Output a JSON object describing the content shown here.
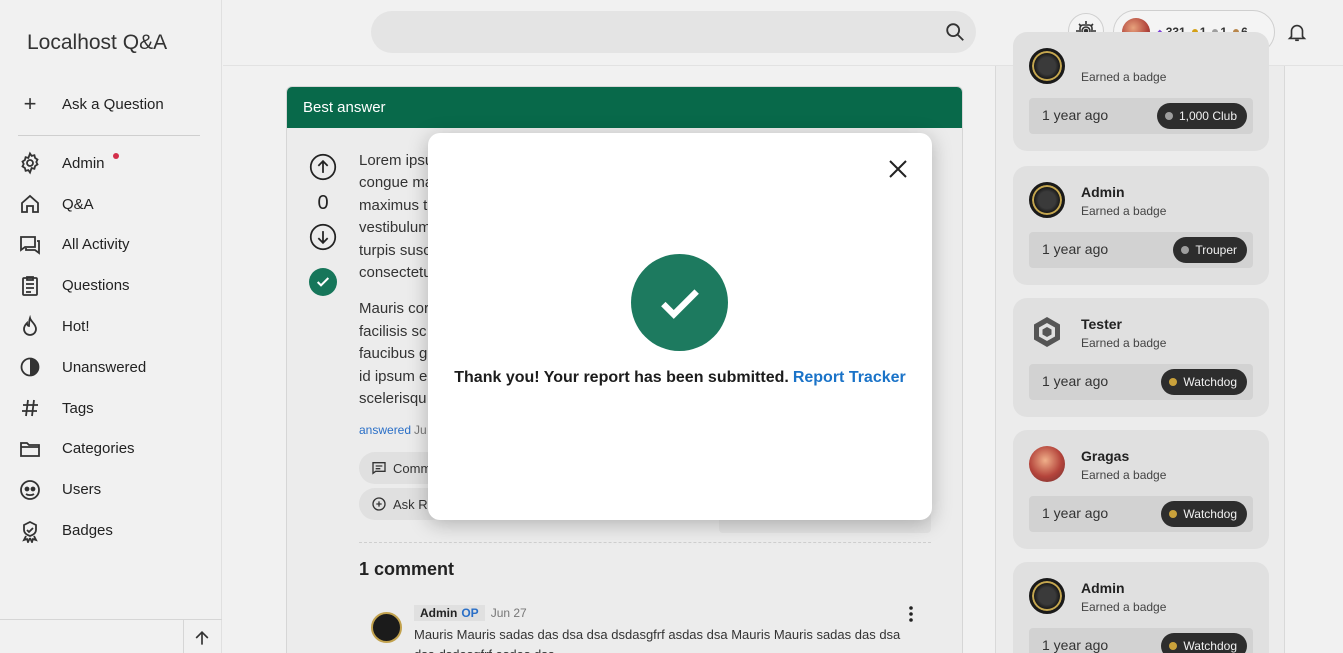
{
  "app": {
    "title": "Localhost Q&A"
  },
  "sidebar": {
    "ask_label": "Ask a Question",
    "items": [
      {
        "label": "Admin",
        "icon": "gear-icon",
        "notify": true
      },
      {
        "label": "Q&A",
        "icon": "home-icon"
      },
      {
        "label": "All Activity",
        "icon": "forum-icon"
      },
      {
        "label": "Questions",
        "icon": "clipboard-icon"
      },
      {
        "label": "Hot!",
        "icon": "flame-icon"
      },
      {
        "label": "Unanswered",
        "icon": "half-circle-icon"
      },
      {
        "label": "Tags",
        "icon": "hash-icon"
      },
      {
        "label": "Categories",
        "icon": "folder-icon"
      },
      {
        "label": "Users",
        "icon": "users-icon"
      },
      {
        "label": "Badges",
        "icon": "badge-icon"
      }
    ]
  },
  "header": {
    "user": {
      "reputation": "331",
      "gold": "1",
      "silver": "1",
      "bronze": "6",
      "colors": {
        "diamond": "#7b3fd6",
        "gold": "#d4a017",
        "silver": "#9e9e9e",
        "bronze": "#b8864b"
      }
    }
  },
  "answer": {
    "header": "Best answer",
    "votes": "0",
    "paragraph1": "Lorem ipsu\ncongue ma\nmaximus t\nvestibulum\nturpis susc\nconsectetu",
    "paragraph2": "Mauris cor\nfacilisis sc\nfaucibus g\nid ipsum e\nscelerisqu",
    "answered_label": "answered",
    "answered_date": "Ju",
    "comment_button": "Comm",
    "ask_related_button": "Ask Re",
    "accent_color": "#08694a"
  },
  "comments": {
    "title": "1 comment",
    "items": [
      {
        "author": "Admin",
        "op_badge": "OP",
        "date": "Jun 27",
        "text": "Mauris Mauris sadas das dsa dsa dsdasgfrf asdas dsa Mauris Mauris sadas das dsa dsa dsdasgfrf asdas dsa"
      }
    ]
  },
  "activity": [
    {
      "name": "",
      "action": "Earned a badge",
      "time": "1 year ago",
      "badge": "1,000 Club",
      "badge_color": "#9e9e9e",
      "avatar": "gold"
    },
    {
      "name": "Admin",
      "action": "Earned a badge",
      "time": "1 year ago",
      "badge": "Trouper",
      "badge_color": "#9e9e9e",
      "avatar": "gold"
    },
    {
      "name": "Tester",
      "action": "Earned a badge",
      "time": "1 year ago",
      "badge": "Watchdog",
      "badge_color": "#c9a13b",
      "avatar": "hex"
    },
    {
      "name": "Gragas",
      "action": "Earned a badge",
      "time": "1 year ago",
      "badge": "Watchdog",
      "badge_color": "#c9a13b",
      "avatar": "fire"
    },
    {
      "name": "Admin",
      "action": "Earned a badge",
      "time": "1 year ago",
      "badge": "Watchdog",
      "badge_color": "#c9a13b",
      "avatar": "gold"
    }
  ],
  "modal": {
    "message": "Thank you! Your report has been submitted.",
    "link_label": "Report Tracker",
    "success_color": "#1d7a5f",
    "link_color": "#1a73c8"
  }
}
